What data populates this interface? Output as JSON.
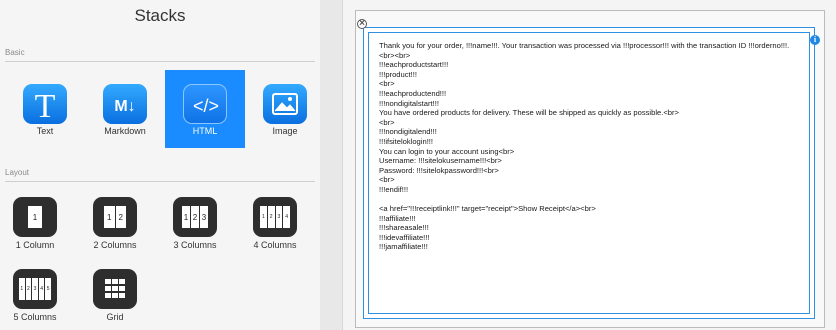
{
  "panel": {
    "title": "Stacks"
  },
  "sections": {
    "basic": "Basic",
    "layout": "Layout"
  },
  "basic_items": [
    {
      "label": "Text",
      "icon": "text-icon"
    },
    {
      "label": "Markdown",
      "icon": "markdown-icon"
    },
    {
      "label": "HTML",
      "icon": "html-code-icon",
      "selected": true
    },
    {
      "label": "Image",
      "icon": "image-icon"
    }
  ],
  "layout_items": [
    {
      "label": "1 Column",
      "icon": "one-column-icon",
      "numbers": [
        "1"
      ]
    },
    {
      "label": "2 Columns",
      "icon": "two-columns-icon",
      "numbers": [
        "1",
        "2"
      ]
    },
    {
      "label": "3 Columns",
      "icon": "three-columns-icon",
      "numbers": [
        "1",
        "2",
        "3"
      ]
    },
    {
      "label": "4 Columns",
      "icon": "four-columns-icon",
      "numbers": [
        "1",
        "2",
        "3",
        "4"
      ]
    },
    {
      "label": "5 Columns",
      "icon": "five-columns-icon",
      "numbers": [
        "1",
        "2",
        "3",
        "4",
        "5"
      ]
    },
    {
      "label": "Grid",
      "icon": "grid-icon"
    }
  ],
  "tile_icons": {
    "T": "T",
    "md": "M↓",
    "html": "</>"
  },
  "html_stack": {
    "content": "Thank you for your order, !!!name!!!. Your transaction was processed via !!!processor!!! with the transaction ID !!!orderno!!!.<br><br>\n!!!eachproductstart!!!\n!!!product!!!\n<br>\n!!!eachproductend!!!\n!!!nondigitalstart!!!\nYou have ordered products for delivery. These will be shipped as quickly as possible.<br>\n<br>\n!!!nondigitalend!!!\n!!!ifsiteloklogin!!!\nYou can login to your account using<br>\nUsername: !!!sitelokusername!!!<br>\nPassword: !!!sitelokpassword!!!<br>\n<br>\n!!!endif!!!\n\n<a href=\"!!!receiptlink!!!\" target=\"receipt\">Show Receipt</a><br>\n!!!affiliate!!!\n!!!shareasale!!!\n!!!idevaffiliate!!!\n!!!jamaffiliate!!!"
  },
  "colors": {
    "accent": "#1a8cff",
    "frame": "#2f8fe0",
    "tile_dark": "#2e2e2e"
  }
}
